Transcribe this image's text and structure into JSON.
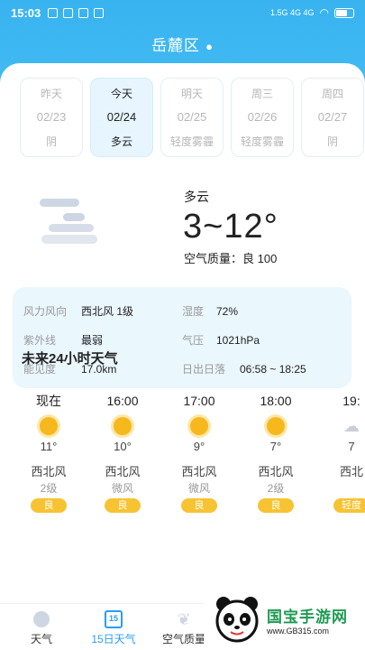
{
  "status_bar": {
    "time": "15:03",
    "signal_text": "1.5G 4G 4G"
  },
  "header": {
    "location": "岳麓区"
  },
  "days": [
    {
      "weekday": "昨天",
      "date": "02/23",
      "condition": "阴",
      "active": false
    },
    {
      "weekday": "今天",
      "date": "02/24",
      "condition": "多云",
      "active": true
    },
    {
      "weekday": "明天",
      "date": "02/25",
      "condition": "轻度雾霾",
      "active": false
    },
    {
      "weekday": "周三",
      "date": "02/26",
      "condition": "轻度雾霾",
      "active": false
    },
    {
      "weekday": "周四",
      "date": "02/27",
      "condition": "阴",
      "active": false
    }
  ],
  "current": {
    "condition": "多云",
    "temperature": "3~12°",
    "air_quality": "空气质量：良 100"
  },
  "details": {
    "wind_label": "风力风向",
    "wind_value": "西北风 1级",
    "humidity_label": "湿度",
    "humidity_value": "72%",
    "uv_label": "紫外线",
    "uv_value": "最弱",
    "pressure_label": "气压",
    "pressure_value": "1021hPa",
    "visibility_label": "能见度",
    "visibility_value": "17.0km",
    "sun_label": "日出日落",
    "sun_value": "06:58 ~ 18:25"
  },
  "hourly": {
    "title": "未来24小时天气",
    "items": [
      {
        "time": "现在",
        "temp": "11°",
        "wind_dir": "西北风",
        "wind_speed": "2级",
        "quality": "良",
        "icon": "sun-icon"
      },
      {
        "time": "16:00",
        "temp": "10°",
        "wind_dir": "西北风",
        "wind_speed": "微风",
        "quality": "良",
        "icon": "sun-icon"
      },
      {
        "time": "17:00",
        "temp": "9°",
        "wind_dir": "西北风",
        "wind_speed": "微风",
        "quality": "良",
        "icon": "sun-icon"
      },
      {
        "time": "18:00",
        "temp": "7°",
        "wind_dir": "西北风",
        "wind_speed": "2级",
        "quality": "良",
        "icon": "sun-icon"
      },
      {
        "time": "19:",
        "temp": "7",
        "wind_dir": "西北",
        "wind_speed": "",
        "quality": "轻度",
        "icon": "moon-cloud-icon"
      }
    ]
  },
  "tabs": [
    {
      "label": "天气",
      "icon": "sun-icon",
      "active": false
    },
    {
      "label": "15日天气",
      "icon": "calendar-icon",
      "active": true,
      "badge": "15"
    },
    {
      "label": "空气质量",
      "icon": "leaf-icon",
      "active": false
    }
  ],
  "watermark": {
    "main": "国宝手游网",
    "sub": "www.GB315.com"
  },
  "colors": {
    "accent": "#38b3f0",
    "quality": "#f7c333",
    "tab_active": "#2a9df4"
  }
}
